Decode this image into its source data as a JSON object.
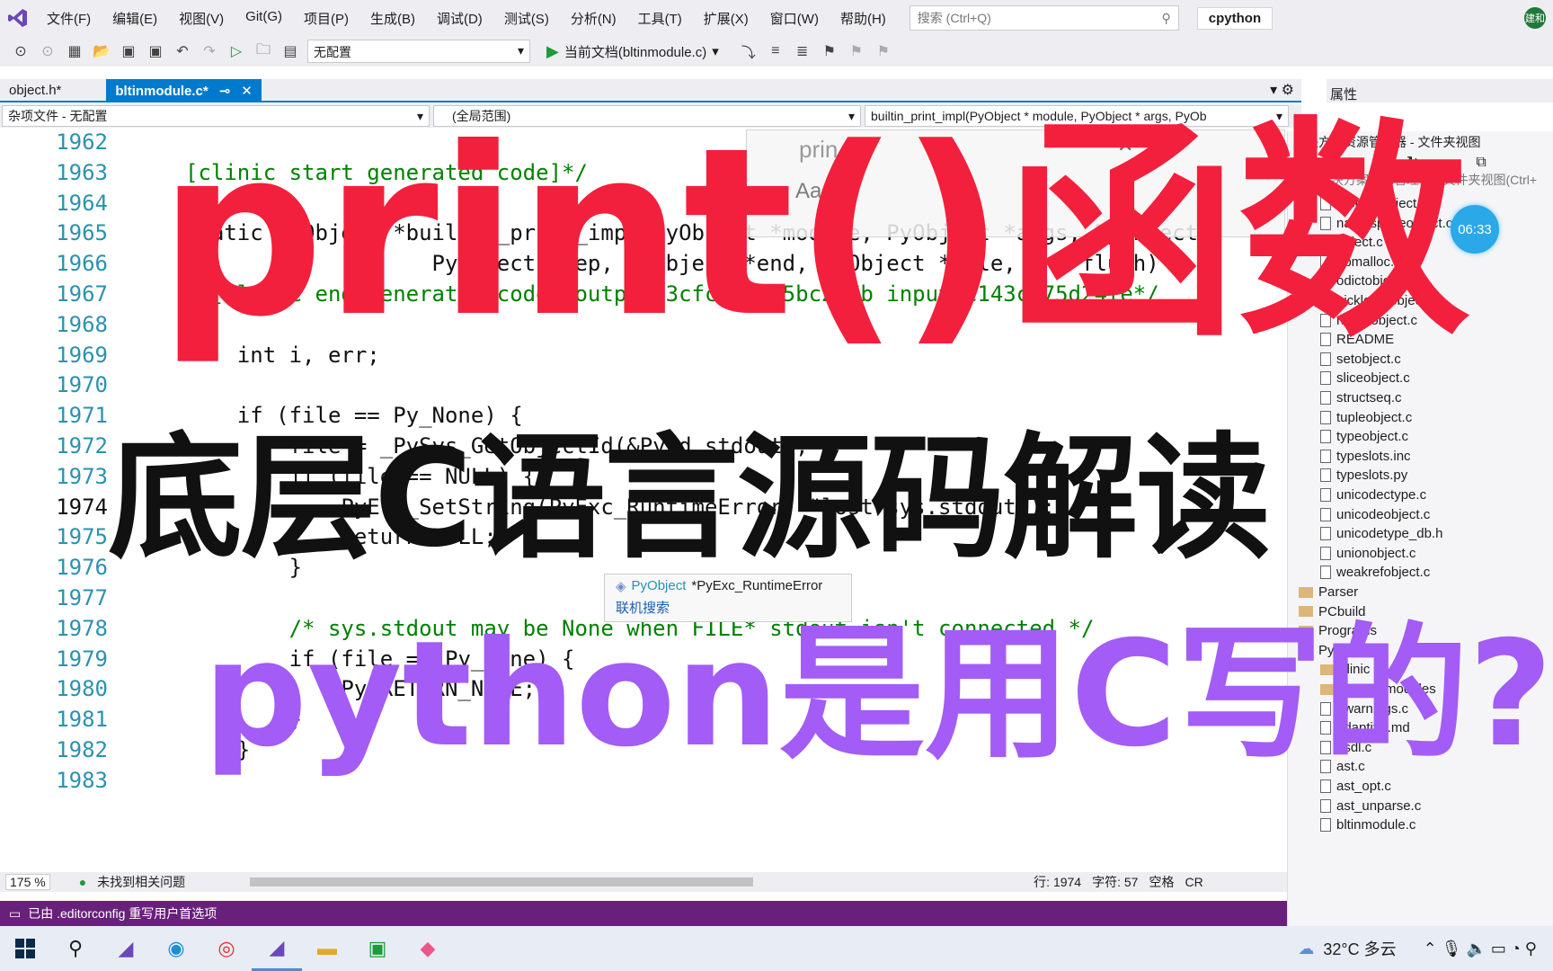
{
  "menu": {
    "items": [
      "文件(F)",
      "编辑(E)",
      "视图(V)",
      "Git(G)",
      "项目(P)",
      "生成(B)",
      "调试(D)",
      "测试(S)",
      "分析(N)",
      "工具(T)",
      "扩展(X)",
      "窗口(W)",
      "帮助(H)"
    ],
    "search_placeholder": "搜索 (Ctrl+Q)",
    "solution_name": "cpython",
    "user_initials": "建和"
  },
  "toolbar": {
    "config": "无配置",
    "run_label": "当前文档(bltinmodule.c)"
  },
  "tabs": [
    {
      "label": "object.h*",
      "active": false
    },
    {
      "label": "bltinmodule.c*",
      "active": true
    }
  ],
  "navbar": {
    "project": "杂项文件 - 无配置",
    "scope": "(全局范围)",
    "function": "builtin_print_impl(PyObject * module, PyObject * args, PyOb"
  },
  "editor": {
    "lines": [
      {
        "no": "1962",
        "code": ""
      },
      {
        "no": "1963",
        "code": "[clinic start generated code]*/"
      },
      {
        "no": "1964",
        "code": ""
      },
      {
        "no": "1965",
        "code": "static PyObject *builtin_print_impl(PyObject *module, PyObject *args, PyObject"
      },
      {
        "no": "1966",
        "code": "                   PyObject *sep, PyObject *end, PyObject *file, int flush)"
      },
      {
        "no": "1967",
        "code": "/*[clinic end generated code: output=3cfc0940f5bc237b input=c143c575d24fe*/"
      },
      {
        "no": "1968",
        "code": ""
      },
      {
        "no": "1969",
        "code": "    int i, err;"
      },
      {
        "no": "1970",
        "code": ""
      },
      {
        "no": "1971",
        "code": "    if (file == Py_None) {"
      },
      {
        "no": "1972",
        "code": "        file = _PySys_GetObjectId(&PyId_stdout);"
      },
      {
        "no": "1973",
        "code": "        if (file == NULL) {"
      },
      {
        "no": "1974",
        "code": "            PyErr_SetString(PyExc_RuntimeError, \"lost sys.stdout\");"
      },
      {
        "no": "1975",
        "code": "            return NULL;"
      },
      {
        "no": "1976",
        "code": "        }"
      },
      {
        "no": "1977",
        "code": ""
      },
      {
        "no": "1978",
        "code": "        /* sys.stdout may be None when FILE* stdout isn't connected */"
      },
      {
        "no": "1979",
        "code": "        if (file == Py_None) {"
      },
      {
        "no": "1980",
        "code": "            Py_RETURN_NONE;"
      },
      {
        "no": "1981",
        "code": "        }"
      },
      {
        "no": "1982",
        "code": "    }"
      },
      {
        "no": "1983",
        "code": ""
      }
    ],
    "find_text": "prin",
    "tooltip_type": "PyObject",
    "tooltip_text": "*PyExc_RuntimeError",
    "tooltip_link": "联机搜索"
  },
  "editor_status": {
    "zoom": "175 %",
    "issues": "未找到相关问题",
    "line": "行: 1974",
    "char": "字符: 57",
    "whitespace": "空格",
    "eol": "CR"
  },
  "statusbar": {
    "message": "已由 .editorconfig 重写用户首选项"
  },
  "right_panel": {
    "properties_label": "属性",
    "explorer_title": "解决方案资源管理器 - 文件夹视图",
    "search_placeholder": "搜索解决方案资源管理器 - 文件夹视图(Ctrl+",
    "timer": "06:33",
    "tree": [
      {
        "label": "moduleobject.c",
        "type": "file",
        "indent": 0
      },
      {
        "label": "namespaceobject.c",
        "type": "file",
        "indent": 0
      },
      {
        "label": "object.c",
        "type": "file",
        "indent": 0
      },
      {
        "label": "obmalloc.c",
        "type": "file",
        "indent": 0
      },
      {
        "label": "odictobject.c",
        "type": "file",
        "indent": 0
      },
      {
        "label": "picklebufobject.c",
        "type": "file",
        "indent": 0
      },
      {
        "label": "rangeobject.c",
        "type": "file",
        "indent": 0
      },
      {
        "label": "README",
        "type": "file",
        "indent": 0
      },
      {
        "label": "setobject.c",
        "type": "file",
        "indent": 0
      },
      {
        "label": "sliceobject.c",
        "type": "file",
        "indent": 0
      },
      {
        "label": "structseq.c",
        "type": "file",
        "indent": 0
      },
      {
        "label": "tupleobject.c",
        "type": "file",
        "indent": 0
      },
      {
        "label": "typeobject.c",
        "type": "file",
        "indent": 0
      },
      {
        "label": "typeslots.inc",
        "type": "file",
        "indent": 0
      },
      {
        "label": "typeslots.py",
        "type": "file",
        "indent": 0
      },
      {
        "label": "unicodectype.c",
        "type": "file",
        "indent": 0
      },
      {
        "label": "unicodeobject.c",
        "type": "file",
        "indent": 0
      },
      {
        "label": "unicodetype_db.h",
        "type": "file",
        "indent": 0
      },
      {
        "label": "unionobject.c",
        "type": "file",
        "indent": 0
      },
      {
        "label": "weakrefobject.c",
        "type": "file",
        "indent": 0
      },
      {
        "label": "Parser",
        "type": "folder",
        "indent": -1
      },
      {
        "label": "PCbuild",
        "type": "folder",
        "indent": -1
      },
      {
        "label": "Programs",
        "type": "folder",
        "indent": -1
      },
      {
        "label": "Python",
        "type": "folder",
        "indent": -1
      },
      {
        "label": "clinic",
        "type": "folder",
        "indent": 0
      },
      {
        "label": "frozen_modules",
        "type": "folder",
        "indent": 0
      },
      {
        "label": "_warnings.c",
        "type": "file",
        "indent": 0
      },
      {
        "label": "adaptive.md",
        "type": "file",
        "indent": 0
      },
      {
        "label": "asdl.c",
        "type": "file",
        "indent": 0
      },
      {
        "label": "ast.c",
        "type": "file",
        "indent": 0
      },
      {
        "label": "ast_opt.c",
        "type": "file",
        "indent": 0
      },
      {
        "label": "ast_unparse.c",
        "type": "file",
        "indent": 0
      },
      {
        "label": "bltinmodule.c",
        "type": "file",
        "indent": 0
      }
    ]
  },
  "taskbar": {
    "weather": "32°C 多云"
  },
  "overlay": {
    "title": "print()函数",
    "subtitle1": "底层C语言源码解读",
    "subtitle2": "python是用C写的?"
  },
  "colors": {
    "accent": "#007acc",
    "statusbar": "#68217a",
    "title_overlay": "#f2203c",
    "subtitle2_overlay": "#a35cf5"
  }
}
